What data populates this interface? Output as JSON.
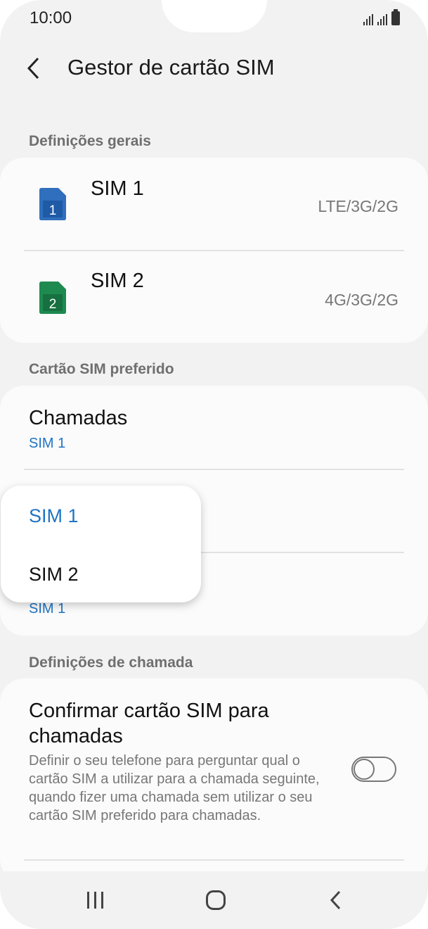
{
  "status_bar": {
    "time": "10:00",
    "icons": [
      "signal-icon",
      "signal-icon",
      "battery-icon"
    ]
  },
  "header": {
    "title": "Gestor de cartão SIM",
    "back_icon": "chevron-left-icon"
  },
  "sections": {
    "general": "Definições gerais",
    "preferred": "Cartão SIM preferido",
    "call_settings": "Definições de chamada"
  },
  "sims": [
    {
      "name": "SIM 1",
      "number": "1",
      "network": "LTE/3G/2G",
      "color": "#2f6fbd"
    },
    {
      "name": "SIM 2",
      "number": "2",
      "network": "4G/3G/2G",
      "color": "#1e8a4f"
    }
  ],
  "preferred": {
    "calls": {
      "label": "Chamadas",
      "value": "SIM 1"
    },
    "hidden_value": "SIM 1"
  },
  "popup": {
    "options": [
      "SIM 1",
      "SIM 2"
    ],
    "selected": "SIM 1"
  },
  "call_settings": {
    "title": "Confirmar cartão SIM para chamadas",
    "description": "Definir o seu telefone para perguntar qual o cartão SIM a utilizar para a chamada seguinte, quando fizer uma chamada sem utilizar o seu cartão SIM preferido para chamadas.",
    "toggle_on": false
  },
  "navbar": {
    "recent": "recent-apps-icon",
    "home": "home-icon",
    "back": "back-icon"
  },
  "colors": {
    "accent": "#1e74c6",
    "background": "#f2f2f2",
    "card": "#fbfbfb"
  }
}
